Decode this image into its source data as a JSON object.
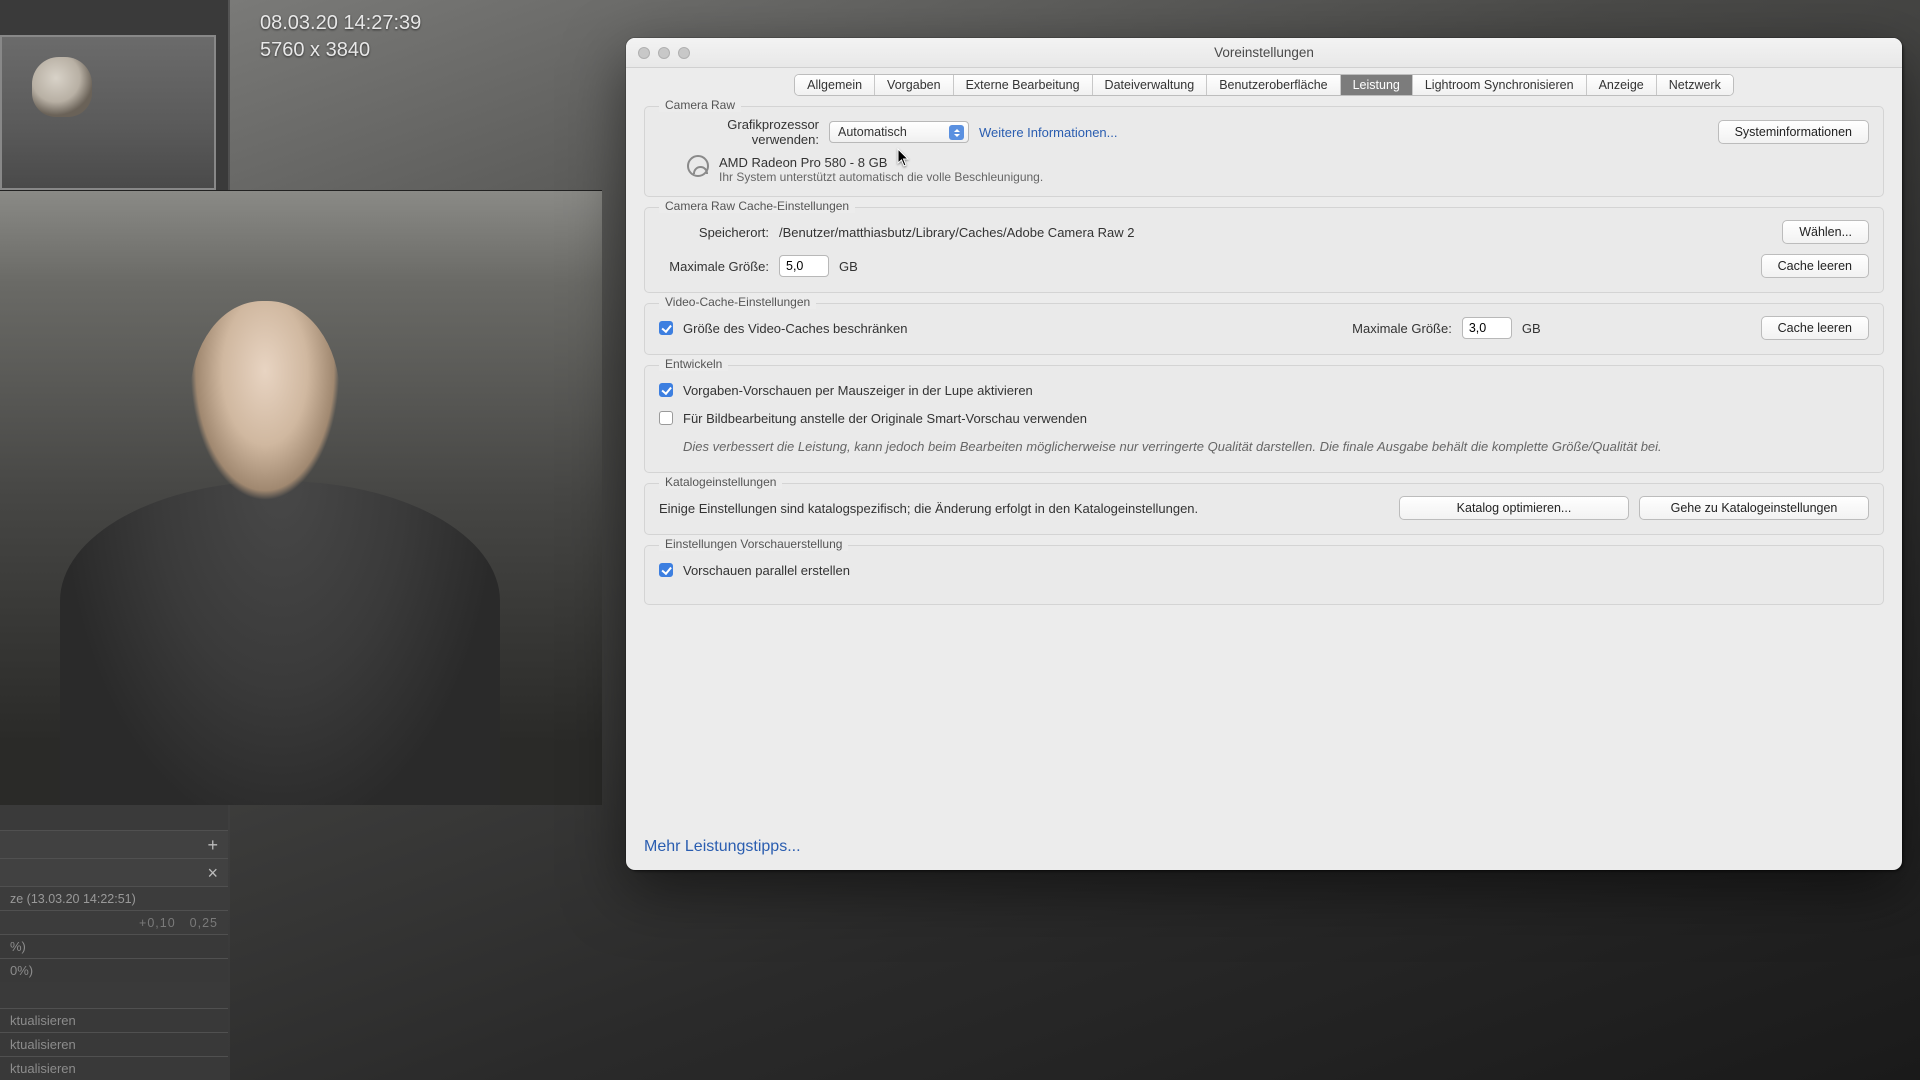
{
  "overlay": {
    "timestamp": "08.03.20 14:27:39",
    "dimensions": "5760 x 3840"
  },
  "sidebar": {
    "history_entry": "ze (13.03.20 14:22:51)",
    "history_nums_a": "+0,10",
    "history_nums_b": "0,25",
    "pct_rows": [
      "%)",
      "0%)"
    ],
    "action_rows": [
      "ktualisieren",
      "ktualisieren",
      "ktualisieren"
    ]
  },
  "modal": {
    "title": "Voreinstellungen",
    "tabs": [
      "Allgemein",
      "Vorgaben",
      "Externe Bearbeitung",
      "Dateiverwaltung",
      "Benutzeroberfläche",
      "Leistung",
      "Lightroom Synchronisieren",
      "Anzeige",
      "Netzwerk"
    ],
    "active_tab_index": 5,
    "camera_raw": {
      "legend": "Camera Raw",
      "gpu_label": "Grafikprozessor verwenden:",
      "gpu_value": "Automatisch",
      "more_info": "Weitere Informationen...",
      "sysinfo_btn": "Systeminformationen",
      "gpu_name": "AMD Radeon Pro 580 - 8 GB",
      "gpu_hint": "Ihr System unterstützt automatisch die volle Beschleunigung."
    },
    "cache": {
      "legend": "Camera Raw Cache-Einstellungen",
      "location_label": "Speicherort:",
      "location_value": "/Benutzer/matthiasbutz/Library/Caches/Adobe Camera Raw 2",
      "choose_btn": "Wählen...",
      "max_label": "Maximale Größe:",
      "max_value": "5,0",
      "unit": "GB",
      "purge_btn": "Cache leeren"
    },
    "video_cache": {
      "legend": "Video-Cache-Einstellungen",
      "limit_check": "Größe des Video-Caches beschränken",
      "max_label": "Maximale Größe:",
      "max_value": "3,0",
      "unit": "GB",
      "purge_btn": "Cache leeren"
    },
    "develop": {
      "legend": "Entwickeln",
      "opt1": "Vorgaben-Vorschauen per Mauszeiger in der Lupe aktivieren",
      "opt2": "Für Bildbearbeitung anstelle der Originale Smart-Vorschau verwenden",
      "opt2_hint": "Dies verbessert die Leistung, kann jedoch beim Bearbeiten möglicherweise nur verringerte Qualität darstellen. Die finale Ausgabe behält die komplette Größe/Qualität bei."
    },
    "catalog": {
      "legend": "Katalogeinstellungen",
      "text": "Einige Einstellungen sind katalogspezifisch; die Änderung erfolgt in den Katalogeinstellungen.",
      "optimize_btn": "Katalog optimieren...",
      "goto_btn": "Gehe zu Katalogeinstellungen"
    },
    "previews": {
      "legend": "Einstellungen Vorschauerstellung",
      "opt1": "Vorschauen parallel erstellen"
    },
    "more_tips": "Mehr Leistungstipps..."
  }
}
